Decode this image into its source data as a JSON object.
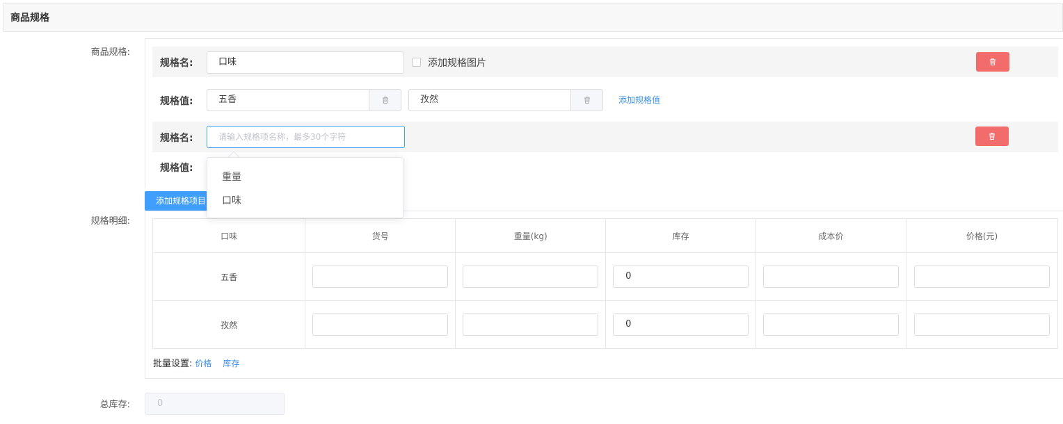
{
  "section": {
    "title": "商品规格"
  },
  "labels": {
    "goods_spec": "商品规格:",
    "spec_detail": "规格明细:",
    "total_stock": "总库存:"
  },
  "spec_groups": [
    {
      "name_label": "规格名:",
      "name_value": "口味",
      "add_image_label": "添加规格图片",
      "values_label": "规格值:",
      "values": [
        "五香",
        "孜然"
      ],
      "add_value_link": "添加规格值"
    },
    {
      "name_label": "规格名:",
      "name_placeholder": "请输入规格项名称，最多30个字符",
      "values_label": "规格值:"
    }
  ],
  "dropdown": {
    "options": [
      "重量",
      "口味"
    ]
  },
  "add_spec_button": "添加规格项目",
  "table": {
    "headers": [
      "口味",
      "货号",
      "重量(kg)",
      "库存",
      "成本价",
      "价格(元)"
    ],
    "rows": [
      {
        "name": "五香",
        "sku": "",
        "weight": "",
        "stock": "0",
        "cost": "",
        "price": ""
      },
      {
        "name": "孜然",
        "sku": "",
        "weight": "",
        "stock": "0",
        "cost": "",
        "price": ""
      }
    ]
  },
  "batch": {
    "label": "批量设置:",
    "price_link": "价格",
    "stock_link": "库存"
  },
  "total_stock": {
    "value": "0"
  },
  "colors": {
    "accent": "#409eff",
    "danger": "#f36c6c",
    "link": "#3a8ee6"
  }
}
